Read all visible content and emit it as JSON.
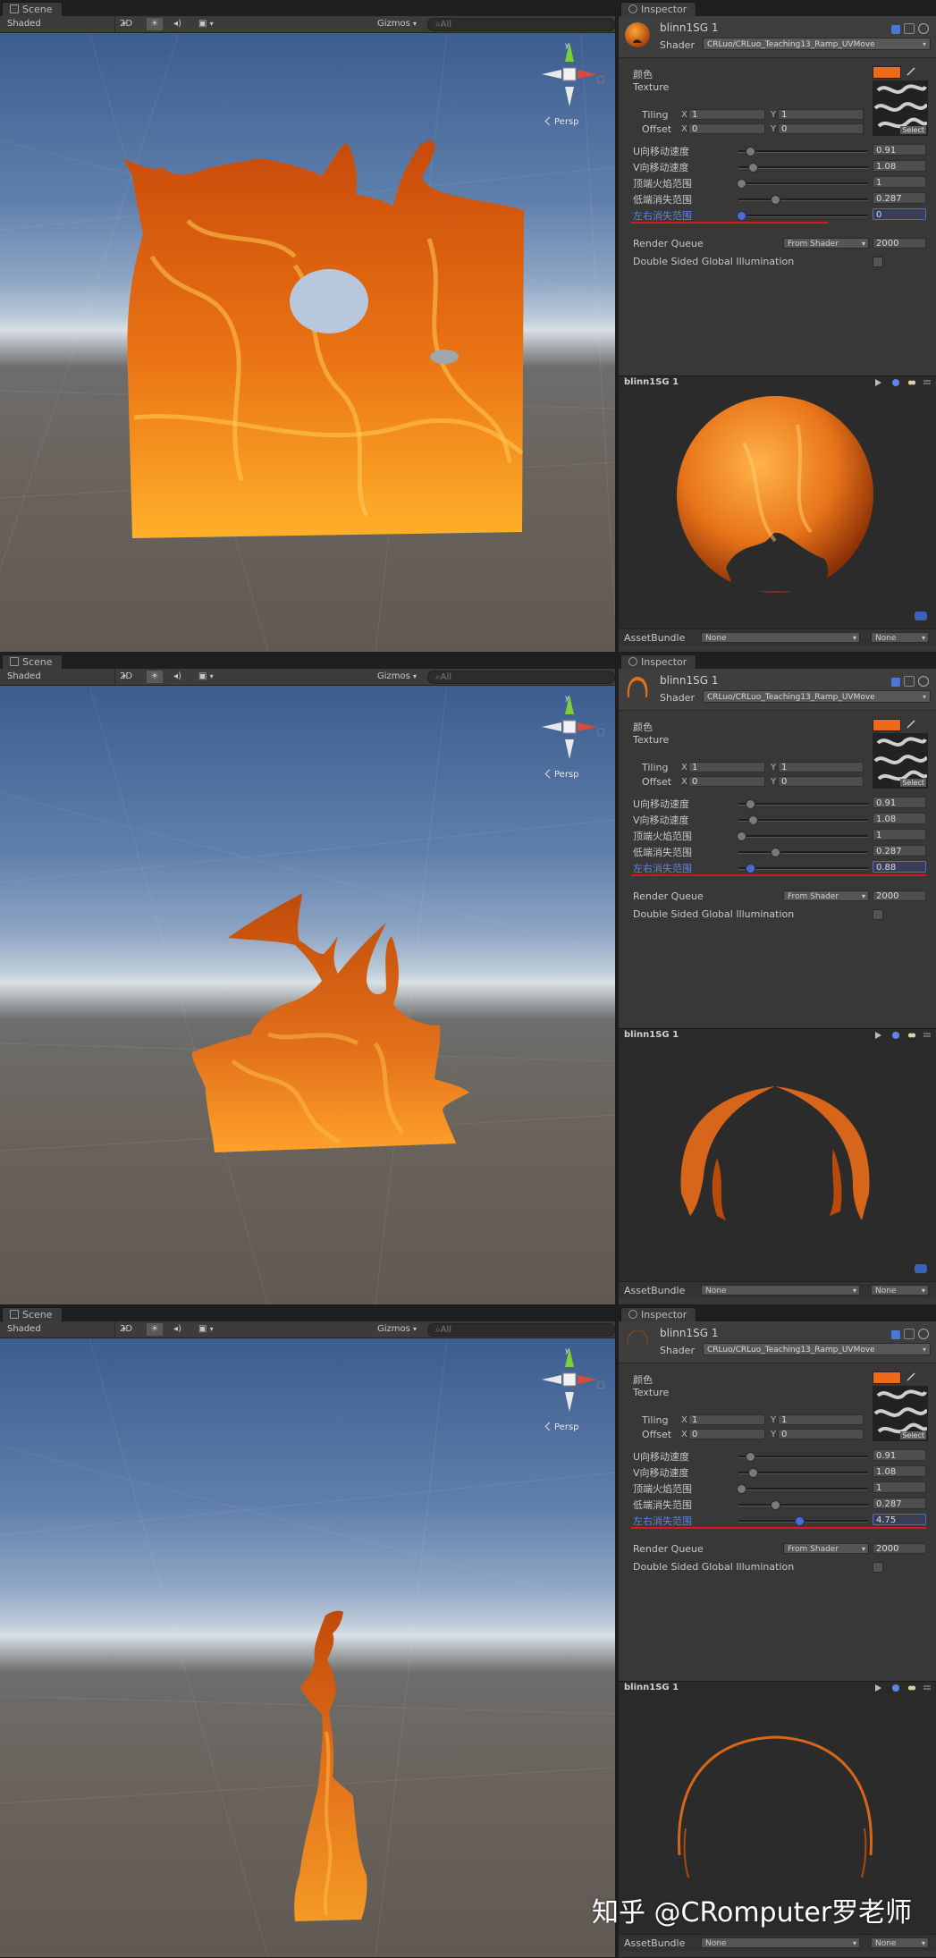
{
  "scene": {
    "tab": "Scene",
    "shading": "Shaded",
    "mode2d": "2D",
    "gizmos": "Gizmos",
    "search_placeholder": "All",
    "persp": "Persp",
    "axis_y": "y"
  },
  "inspector": {
    "tab": "Inspector",
    "material_name": "blinn1SG 1",
    "shader_label": "Shader",
    "shader_value": "CRLuo/CRLuo_Teaching13_Ramp_UVMove",
    "color_label": "颜色",
    "texture_label": "Texture",
    "select_label": "Select",
    "tiling_label": "Tiling",
    "offset_label": "Offset",
    "x_label": "X",
    "y_label": "Y",
    "tiling_x": "1",
    "tiling_y": "1",
    "offset_x": "0",
    "offset_y": "0",
    "render_queue_label": "Render Queue",
    "render_queue_mode": "From Shader",
    "render_queue_value": "2000",
    "dsgi_label": "Double Sided Global Illumination",
    "preview_name": "blinn1SG 1",
    "assetbundle_label": "AssetBundle",
    "assetbundle_value": "None",
    "assetbundle_variant": "None",
    "accent_color": "#ee6a18",
    "active_color": "#5a86e8"
  },
  "sliders": [
    {
      "label": "U向移动速度",
      "value": "0.91"
    },
    {
      "label": "V向移动速度",
      "value": "1.08"
    },
    {
      "label": "顶端火焰范围",
      "value": "1"
    },
    {
      "label": "低端消失范围",
      "value": "0.287"
    },
    {
      "label": "左右消失范围",
      "active": true
    }
  ],
  "states": [
    {
      "lr_value": "0",
      "lr_fraction": 0.02
    },
    {
      "lr_value": "0.88",
      "lr_fraction": 0.09
    },
    {
      "lr_value": "4.75",
      "lr_fraction": 0.47
    }
  ],
  "slider_fractions": [
    0.09,
    0.11,
    0.02,
    0.28
  ],
  "watermark": "知乎 @CRomputer罗老师"
}
